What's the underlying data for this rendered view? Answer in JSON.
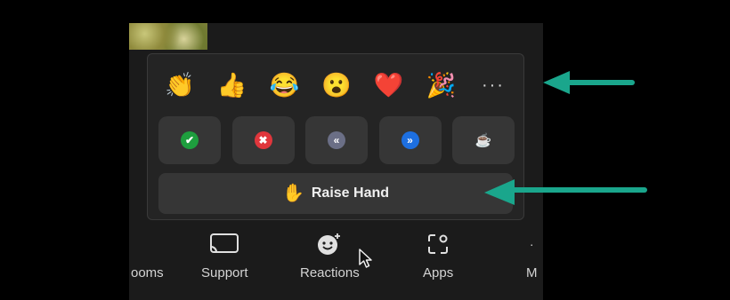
{
  "reactions_panel": {
    "emojis": [
      {
        "name": "clap",
        "glyph": "👏"
      },
      {
        "name": "thumbs-up",
        "glyph": "👍"
      },
      {
        "name": "tears-of-joy",
        "glyph": "😂"
      },
      {
        "name": "open-mouth",
        "glyph": "😮"
      },
      {
        "name": "heart",
        "glyph": "❤️"
      },
      {
        "name": "party-popper",
        "glyph": "🎉"
      }
    ],
    "more_label": "···",
    "status_buttons": [
      {
        "name": "yes",
        "glyph": "✔",
        "color": "#1e9e3e"
      },
      {
        "name": "no",
        "glyph": "✖",
        "color": "#e0363c"
      },
      {
        "name": "slow-down",
        "glyph": "«",
        "color": "#6b6f86"
      },
      {
        "name": "speed-up",
        "glyph": "»",
        "color": "#1d6fe0"
      },
      {
        "name": "coffee-break",
        "glyph": "☕",
        "color": "#e6e6e6"
      }
    ],
    "raise_hand": {
      "label": "Raise Hand",
      "glyph": "✋"
    }
  },
  "toolbar": {
    "rooms_label": "ooms",
    "support_label": "Support",
    "reactions_label": "Reactions",
    "apps_label": "Apps",
    "more_label": "M"
  },
  "colors": {
    "annotation_arrow": "#1aa68c",
    "panel_bg": "#242424",
    "button_bg": "#363636"
  }
}
